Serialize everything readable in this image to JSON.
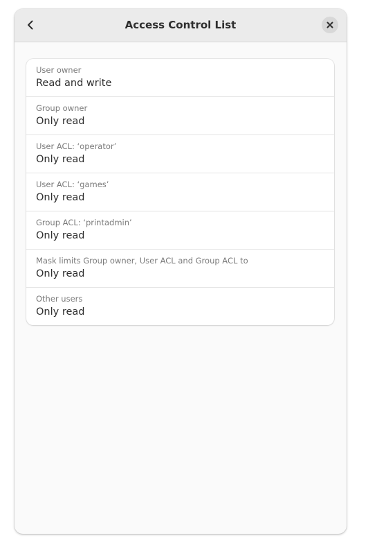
{
  "header": {
    "title": "Access Control List",
    "back_icon": "chevron-left-icon",
    "close_icon": "close-icon"
  },
  "acl": {
    "rows": [
      {
        "subtitle": "User owner",
        "value": "Read and write"
      },
      {
        "subtitle": "Group owner",
        "value": "Only read"
      },
      {
        "subtitle": "User ACL: ‘operator’",
        "value": "Only read"
      },
      {
        "subtitle": "User ACL: ‘games’",
        "value": "Only read"
      },
      {
        "subtitle": "Group ACL: ‘printadmin’",
        "value": "Only read"
      },
      {
        "subtitle": "Mask limits Group owner, User ACL and Group ACL to",
        "value": "Only read"
      },
      {
        "subtitle": "Other users",
        "value": "Only read"
      }
    ]
  }
}
